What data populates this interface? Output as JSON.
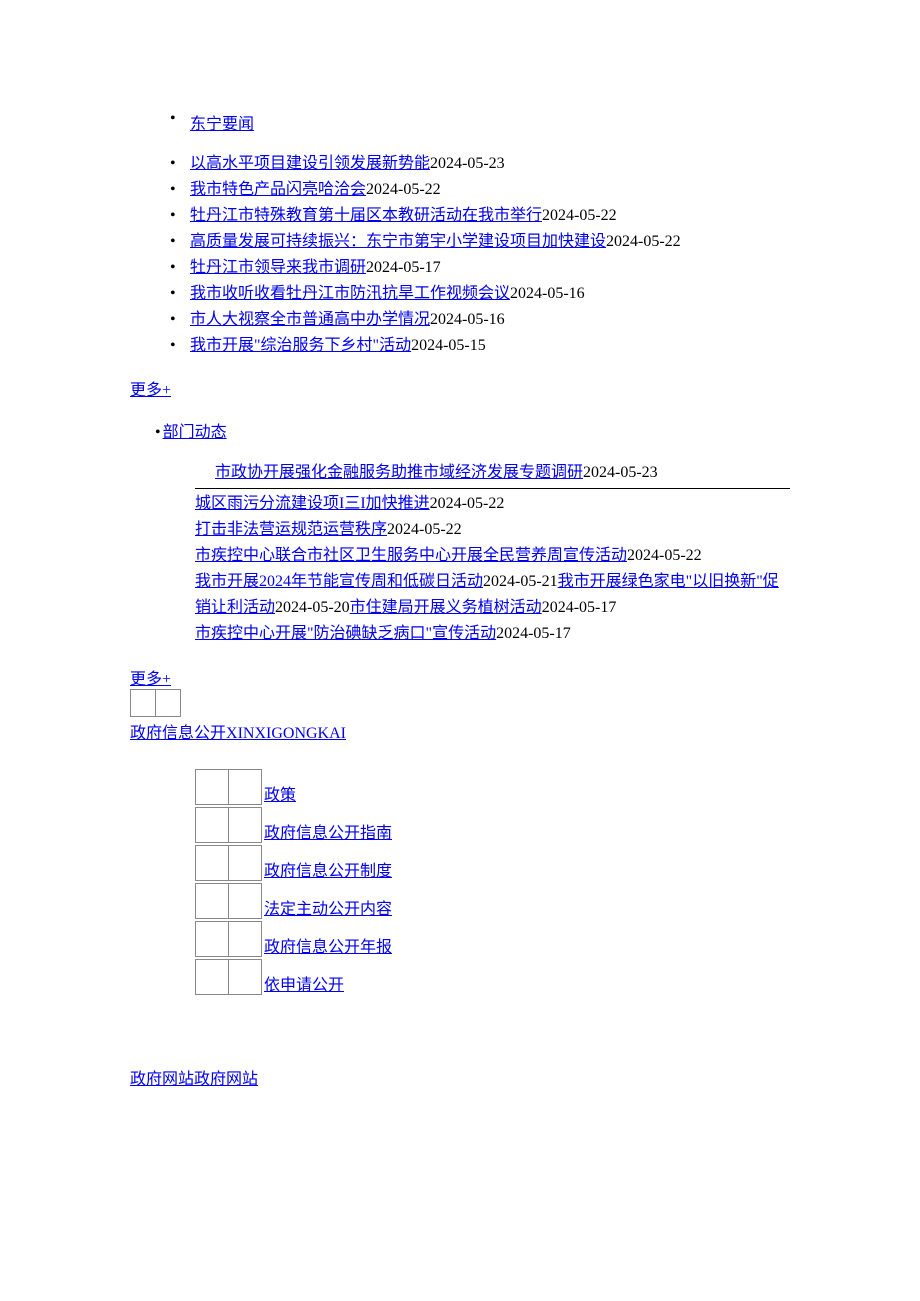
{
  "tabs": {
    "news_tab": "东宁要闻",
    "dept_tab": "部门动态"
  },
  "news_list": [
    {
      "title": "以高水平项目建设引领发展新势能",
      "date": "2024-05-23"
    },
    {
      "title": "我市特色产品闪亮哈洽会",
      "date": "2024-05-22"
    },
    {
      "title": "牡丹江市特殊教育第十届区本教研活动在我市举行",
      "date": "2024-05-22"
    },
    {
      "title": "高质量发展可持续振兴：东宁市第宇小学建设项目加快建设",
      "date": "2024-05-22"
    },
    {
      "title": "牡丹江市领导来我市调研",
      "date": "2024-05-17"
    },
    {
      "title": "我市收听收看牡丹江市防汛抗旱工作视频会议",
      "date": "2024-05-16"
    },
    {
      "title": "市人大视察全市普通高中办学情况",
      "date": "2024-05-16"
    },
    {
      "title": "我市开展\"综治服务下乡村\"活动",
      "date": "2024-05-15"
    }
  ],
  "dept_list": {
    "item0": {
      "title": "市政协开展强化金融服务助推市域经济发展专题调研",
      "date": "2024-05-23"
    },
    "item1": {
      "title": "城区雨污分流建设项I三I加快推进",
      "date": "2024-05-22"
    },
    "item2": {
      "title": "打击非法营运规范运营秩序",
      "date": "2024-05-22"
    },
    "item3": {
      "title": "市疾控中心联合市社区卫生服务中心开展全民营养周宣传活动",
      "date": "2024-05-22"
    },
    "item4": {
      "title": "我市开展2024年节能宣传周和低碳日活动",
      "date": "2024-05-21"
    },
    "item5": {
      "title": "我市开展绿色家电\"以旧换新\"促销让利活动",
      "date": "2024-05-20"
    },
    "item6": {
      "title": "市住建局开展义务植树活动",
      "date": "2024-05-17"
    },
    "item7": {
      "title": "市疾控中心开展\"防治碘缺乏病口\"宣传活动",
      "date": "2024-05-17"
    }
  },
  "more_label": "更多+",
  "info_open": {
    "title_cn": "政府信息公开",
    "title_py": "XINXIGONGKAI",
    "items": [
      "政策",
      "政府信息公开指南",
      "政府信息公开制度",
      "法定主动公开内容",
      "政府信息公开年报",
      "依申请公开"
    ]
  },
  "gov_site": {
    "label1": "政府网站",
    "label2": "政府网站"
  }
}
